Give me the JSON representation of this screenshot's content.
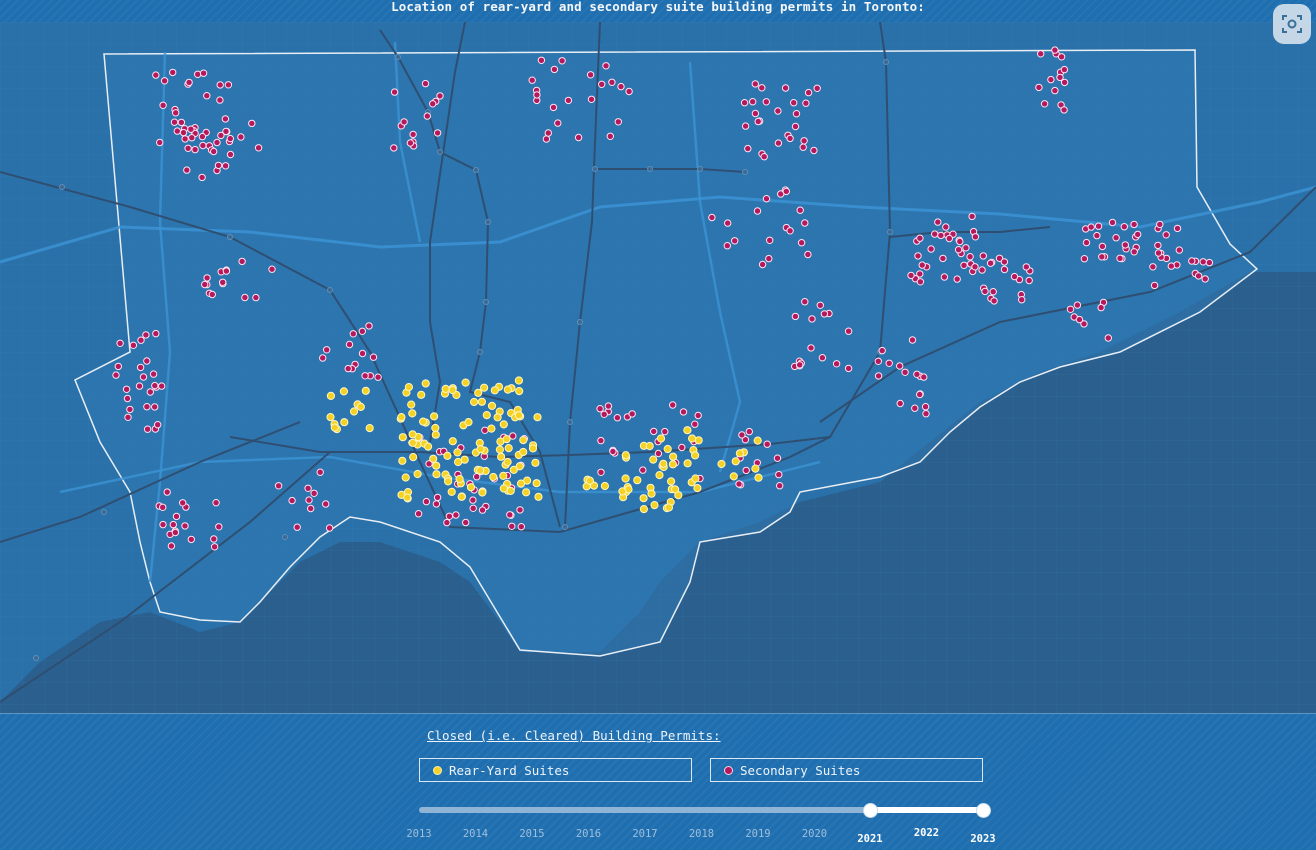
{
  "title": "Location of rear-yard and secondary suite building permits in Toronto:",
  "colors": {
    "rear_yard": "#f4d225",
    "secondary": "#b4195e",
    "land": "#2b71a9",
    "water": "#2a5f8e",
    "boundary": "#e8eef5"
  },
  "controls": {
    "heading": "Closed (i.e. Cleared) Building Permits:",
    "rear_yard_label": "Rear-Yard Suites",
    "secondary_label": "Secondary Suites",
    "years": [
      "2013",
      "2014",
      "2015",
      "2016",
      "2017",
      "2018",
      "2019",
      "2020",
      "2021",
      "2022",
      "2023"
    ],
    "selected_range": [
      "2021",
      "2023"
    ]
  },
  "icons": {
    "screenshot": "camera-scan-icon"
  }
}
